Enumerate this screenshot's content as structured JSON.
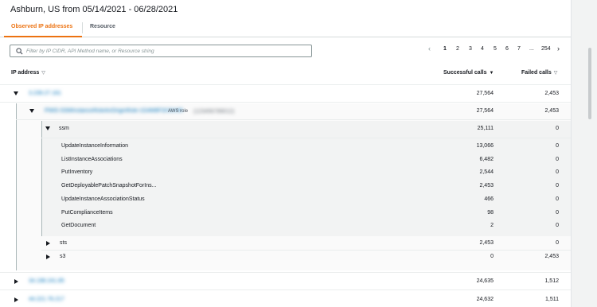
{
  "header": {
    "title": "Ashburn, US from 05/14/2021 - 06/28/2021"
  },
  "tabs": [
    {
      "label": "Observed IP addresses",
      "active": true
    },
    {
      "label": "Resource",
      "active": false
    }
  ],
  "filter": {
    "placeholder": "Filter by IP CIDR, API Method name, or Resource string",
    "value": ""
  },
  "pagination": {
    "prev": "‹",
    "pages": [
      "1",
      "2",
      "3",
      "4",
      "5",
      "6",
      "7"
    ],
    "ellipsis": "...",
    "last": "254",
    "next": "›",
    "current": "1"
  },
  "columns": {
    "ip": "IP address",
    "successful": "Successful calls",
    "failed": "Failed calls"
  },
  "colors": {
    "accent": "#ec7211",
    "link": "#0073bb"
  },
  "rows": {
    "ip1": {
      "label": "3.239.27.161",
      "successful": "27,564",
      "failed": "2,453"
    },
    "role": {
      "label": "PIMS-SSMInstanceRoleAnOriginRole-1G4M8F3X3VHR",
      "type": "AWS role",
      "account": "(123456789012)",
      "successful": "27,564",
      "failed": "2,453"
    },
    "ssm": {
      "label": "ssm",
      "successful": "25,111",
      "failed": "0"
    },
    "methods": [
      {
        "label": "UpdateInstanceInformation",
        "successful": "13,066",
        "failed": "0"
      },
      {
        "label": "ListInstanceAssociations",
        "successful": "6,482",
        "failed": "0"
      },
      {
        "label": "PutInventory",
        "successful": "2,544",
        "failed": "0"
      },
      {
        "label": "GetDeployablePatchSnapshotForIns...",
        "successful": "2,453",
        "failed": "0"
      },
      {
        "label": "UpdateInstanceAssociationStatus",
        "successful": "466",
        "failed": "0"
      },
      {
        "label": "PutComplianceItems",
        "successful": "98",
        "failed": "0"
      },
      {
        "label": "GetDocument",
        "successful": "2",
        "failed": "0"
      }
    ],
    "sts": {
      "label": "sts",
      "successful": "2,453",
      "failed": "0"
    },
    "s3": {
      "label": "s3",
      "successful": "0",
      "failed": "2,453"
    },
    "ip2": {
      "label": "34.198.241.85",
      "successful": "24,635",
      "failed": "1,512"
    },
    "ip3": {
      "label": "44.221.76.217",
      "successful": "24,632",
      "failed": "1,511"
    }
  }
}
